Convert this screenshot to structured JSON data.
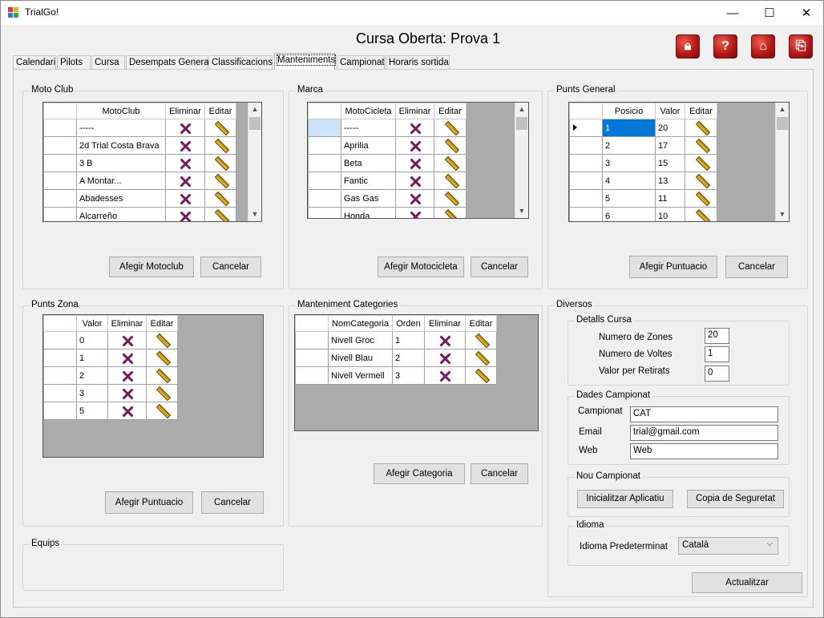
{
  "window": {
    "title": "TrialGo!",
    "minimize": "—",
    "maximize": "☐",
    "close": "✕"
  },
  "heading": "Cursa Oberta: Prova 1",
  "toolbar_icons": [
    "lock-icon",
    "help-icon",
    "home-icon",
    "exit-icon"
  ],
  "tabs": [
    "Calendari",
    "Pilots",
    "Cursa",
    "Desempats General",
    "Classificacions",
    "Manteniments",
    "Campionat",
    "Horaris sortida"
  ],
  "active_tab": "Manteniments",
  "motoclub": {
    "label": "Moto Club",
    "headers": [
      "MotoClub",
      "Eliminar",
      "Editar"
    ],
    "rows": [
      "-----",
      "2d Trial Costa Brava",
      "3 B",
      "A Montar...",
      "Abadesses",
      "Alcarreño"
    ],
    "add_button": "Afegir Motoclub",
    "cancel_button": "Cancelar"
  },
  "marca": {
    "label": "Marca",
    "headers": [
      "MotoCicleta",
      "Eliminar",
      "Editar"
    ],
    "rows": [
      "-----",
      "Aprilia",
      "Beta",
      "Fantic",
      "Gas Gas",
      "Honda"
    ],
    "add_button": "Afegir Motocicleta",
    "cancel_button": "Cancelar"
  },
  "punts_general": {
    "label": "Punts General",
    "headers": [
      "Posicio",
      "Valor",
      "Editar"
    ],
    "rows": [
      {
        "pos": "1",
        "val": "20"
      },
      {
        "pos": "2",
        "val": "17"
      },
      {
        "pos": "3",
        "val": "15"
      },
      {
        "pos": "4",
        "val": "13"
      },
      {
        "pos": "5",
        "val": "11"
      },
      {
        "pos": "6",
        "val": "10"
      }
    ],
    "add_button": "Afegir Puntuacio",
    "cancel_button": "Cancelar"
  },
  "punts_zona": {
    "label": "Punts Zona",
    "headers": [
      "Valor",
      "Eliminar",
      "Editar"
    ],
    "rows": [
      "0",
      "1",
      "2",
      "3",
      "5"
    ],
    "add_button": "Afegir Puntuacio",
    "cancel_button": "Cancelar"
  },
  "categories": {
    "label": "Manteniment Categories",
    "headers": [
      "NomCategoria",
      "Orden",
      "Eliminar",
      "Editar"
    ],
    "rows": [
      {
        "name": "Nivell Groc",
        "order": "1"
      },
      {
        "name": "Nivell Blau",
        "order": "2"
      },
      {
        "name": "Nivell Vermell",
        "order": "3"
      }
    ],
    "add_button": "Afegir Categoria",
    "cancel_button": "Cancelar"
  },
  "equips": {
    "label": "Equips"
  },
  "diversos": {
    "label": "Diversos",
    "detalls": {
      "label": "Detalls Cursa",
      "zones_label": "Numero de Zones",
      "zones": "20",
      "voltes_label": "Numero de Voltes",
      "voltes": "1",
      "retirats_label": "Valor per Retirats",
      "retirats": "0"
    },
    "dades": {
      "label": "Dades Campionat",
      "campionat_label": "Campionat",
      "campionat": "CAT",
      "email_label": "Email",
      "email": "trial@gmail.com",
      "web_label": "Web",
      "web": "Web"
    },
    "nou": {
      "label": "Nou Campionat",
      "init_button": "Inicialitzar Aplicatiu",
      "backup_button": "Copia de Seguretat"
    },
    "idioma": {
      "label": "Idioma",
      "pred_label": "Idioma Predeterminat",
      "value": "Català"
    },
    "update_button": "Actualitzar"
  },
  "colors": {
    "selection": "#0078d7",
    "grid_bg": "#ababab",
    "icon_red": "#c01818"
  }
}
